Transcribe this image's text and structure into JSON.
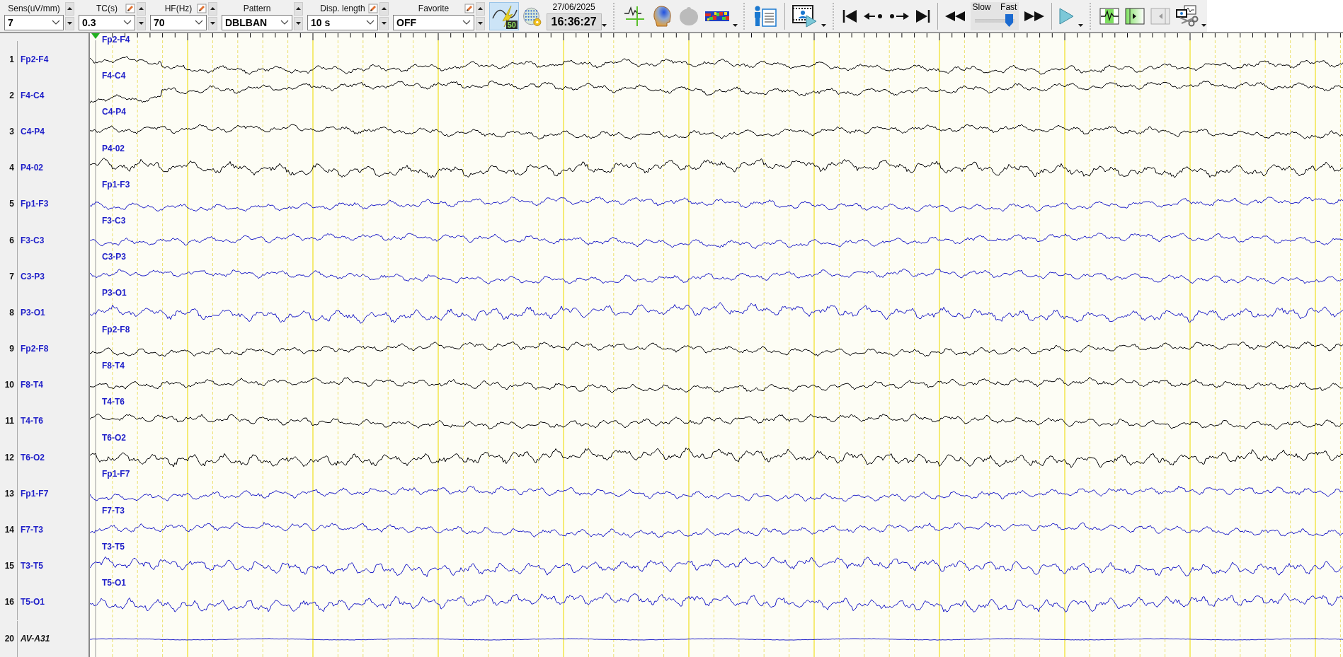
{
  "toolbar": {
    "fields": [
      {
        "label": "Sens(uV/mm)",
        "value": "7",
        "editable": false
      },
      {
        "label": "TC(s)",
        "value": "0.3",
        "editable": true
      },
      {
        "label": "HF(Hz)",
        "value": "70",
        "editable": true
      },
      {
        "label": "Pattern",
        "value": "DBLBAN",
        "editable": false
      },
      {
        "label": "Disp. length",
        "value": "10 s",
        "editable": true
      },
      {
        "label": "Favorite",
        "value": "OFF",
        "editable": true
      }
    ],
    "notch": {
      "label": "50",
      "selected": true
    },
    "date": "27/06/2025",
    "time": "16:36:27",
    "speed": {
      "slow_label": "Slow",
      "fast_label": "Fast",
      "level": 0.85
    }
  },
  "channels": [
    {
      "number": "1",
      "name": "Fp2-F4",
      "trace_label": "Fp2-F4",
      "kind": "bipolar",
      "color": "#000000"
    },
    {
      "number": "2",
      "name": "F4-C4",
      "trace_label": "F4-C4",
      "kind": "bipolar",
      "color": "#000000"
    },
    {
      "number": "3",
      "name": "C4-P4",
      "trace_label": "C4-P4",
      "kind": "bipolar",
      "color": "#000000"
    },
    {
      "number": "4",
      "name": "P4-02",
      "trace_label": "P4-02",
      "kind": "bipolar",
      "color": "#000000"
    },
    {
      "number": "5",
      "name": "Fp1-F3",
      "trace_label": "Fp1-F3",
      "kind": "bipolar",
      "color": "#1c1cc8"
    },
    {
      "number": "6",
      "name": "F3-C3",
      "trace_label": "F3-C3",
      "kind": "bipolar",
      "color": "#1c1cc8"
    },
    {
      "number": "7",
      "name": "C3-P3",
      "trace_label": "C3-P3",
      "kind": "bipolar",
      "color": "#1c1cc8"
    },
    {
      "number": "8",
      "name": "P3-O1",
      "trace_label": "P3-O1",
      "kind": "bipolar",
      "color": "#1c1cc8"
    },
    {
      "number": "9",
      "name": "Fp2-F8",
      "trace_label": "Fp2-F8",
      "kind": "bipolar",
      "color": "#000000"
    },
    {
      "number": "10",
      "name": "F8-T4",
      "trace_label": "F8-T4",
      "kind": "bipolar",
      "color": "#000000"
    },
    {
      "number": "11",
      "name": "T4-T6",
      "trace_label": "T4-T6",
      "kind": "bipolar",
      "color": "#000000"
    },
    {
      "number": "12",
      "name": "T6-O2",
      "trace_label": "T6-O2",
      "kind": "bipolar",
      "color": "#000000"
    },
    {
      "number": "13",
      "name": "Fp1-F7",
      "trace_label": "Fp1-F7",
      "kind": "bipolar",
      "color": "#1c1cc8"
    },
    {
      "number": "14",
      "name": "F7-T3",
      "trace_label": "F7-T3",
      "kind": "bipolar",
      "color": "#1c1cc8"
    },
    {
      "number": "15",
      "name": "T3-T5",
      "trace_label": "T3-T5",
      "kind": "bipolar",
      "color": "#1c1cc8"
    },
    {
      "number": "16",
      "name": "T5-O1",
      "trace_label": "T5-O1",
      "kind": "bipolar",
      "color": "#1c1cc8"
    },
    {
      "number": "20",
      "name": "AV-A31",
      "kind": "average",
      "color": "#1c1cc8"
    }
  ]
}
